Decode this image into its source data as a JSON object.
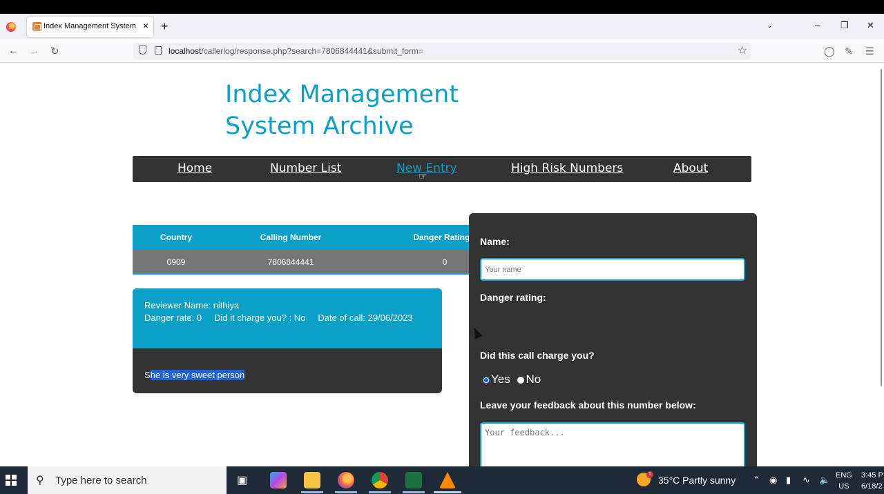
{
  "browser": {
    "tab_title": "Index Management System",
    "url_host": "localhost",
    "url_path": "/callerlog/response.php?search=7806844441&submit_form="
  },
  "site": {
    "title_line1": "Index Management",
    "title_line2": "System Archive"
  },
  "menu": {
    "items": [
      {
        "label": "Home"
      },
      {
        "label": "Number List"
      },
      {
        "label": "New Entry"
      },
      {
        "label": "High Risk Numbers"
      },
      {
        "label": "About"
      }
    ]
  },
  "table": {
    "headers": [
      "Country",
      "Calling Number",
      "Danger Rating ("
    ],
    "row": [
      "0909",
      "7806844441",
      "0"
    ]
  },
  "review": {
    "reviewer": "Reviewer Name: nithiya",
    "danger_rate": "Danger rate: 0",
    "charge": "Did it charge you? : No",
    "date": "Date of call: 29/06/2023",
    "comment_first": "S",
    "comment_rest": "he is very sweet person"
  },
  "form": {
    "name_label": "Name:",
    "name_placeholder": "Your name",
    "danger_label": "Danger rating:",
    "charge_label": "Did this call charge you?",
    "yes_label": "Yes",
    "no_label": "No",
    "feedback_label": "Leave your feedback about this number below:",
    "feedback_placeholder": "Your feedback..."
  },
  "taskbar": {
    "search_text": "Type here to search",
    "weather": "35°C  Partly sunny",
    "weather_badge": "1",
    "lang_line1": "ENG",
    "lang_line2": "US",
    "time": "3:45 P",
    "date": "6/18/2"
  },
  "colors": {
    "accent": "#0aa0c8",
    "panel": "#333333",
    "row": "#777777",
    "selection": "#1d63d8"
  }
}
